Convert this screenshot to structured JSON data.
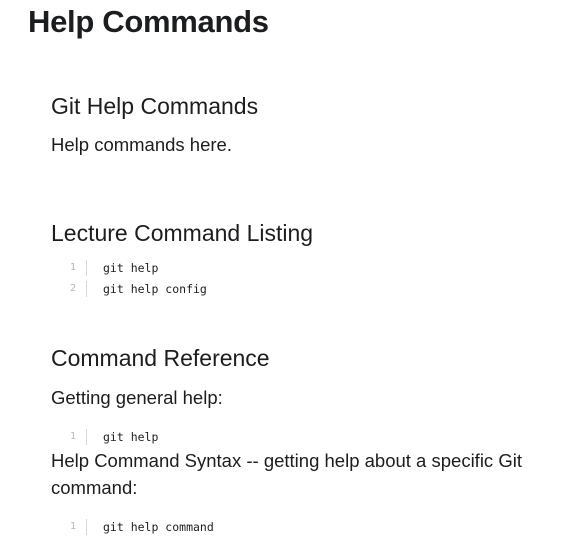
{
  "page": {
    "title": "Help Commands"
  },
  "sections": [
    {
      "heading": "Git Help Commands",
      "paragraph": "Help commands here."
    },
    {
      "heading": "Lecture Command Listing",
      "code": [
        {
          "num": "1",
          "text": "git help"
        },
        {
          "num": "2",
          "text": "git help config"
        }
      ]
    },
    {
      "heading": "Command Reference",
      "paragraph": "Getting general help:",
      "code": [
        {
          "num": "1",
          "text": "git help"
        }
      ],
      "paragraph2": "Help Command Syntax -- getting help about a specific Git command:",
      "code2": [
        {
          "num": "1",
          "text": "git help command"
        }
      ]
    }
  ]
}
